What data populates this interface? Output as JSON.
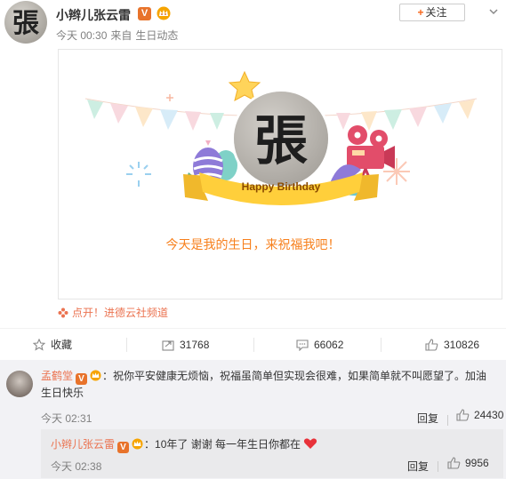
{
  "post": {
    "author": "小辫儿张云雷",
    "verified_badge": "V",
    "follow_label": "关注",
    "follow_plus": "+",
    "time": "今天 00:30",
    "source_prefix": "来自",
    "source": "生日动态"
  },
  "card": {
    "avatar_char": "張",
    "ribbon_text": "Happy Birthday",
    "message": "今天是我的生日，来祝福我吧！"
  },
  "link": {
    "label": "点开！进德云社频道"
  },
  "actions": {
    "favorite_label": "收藏",
    "repost_count": "31768",
    "comment_count": "66062",
    "like_count": "310826"
  },
  "comments": [
    {
      "author": "孟鹤堂",
      "verified_badge": "V",
      "text": "：祝你平安健康无烦恼，祝福虽简单但实现会很难，如果简单就不叫愿望了。加油  生日快乐",
      "time": "今天 02:31",
      "reply_label": "回复",
      "likes": "24430"
    }
  ],
  "sub_reply": {
    "author": "小辫儿张云雷",
    "verified_badge": "V",
    "text": "：10年了 谢谢 每一年生日你都在",
    "time": "今天 02:38",
    "reply_label": "回复",
    "likes": "9956"
  },
  "colors": {
    "accent_orange": "#f7801d",
    "link_orange": "#eb7350",
    "heart_red": "#e8323a"
  },
  "icons": [
    "crown-badge-icon",
    "chevron-down-icon",
    "flower-icon",
    "star-outline-icon",
    "repost-icon",
    "comment-icon",
    "thumbs-up-icon",
    "heart-icon"
  ]
}
